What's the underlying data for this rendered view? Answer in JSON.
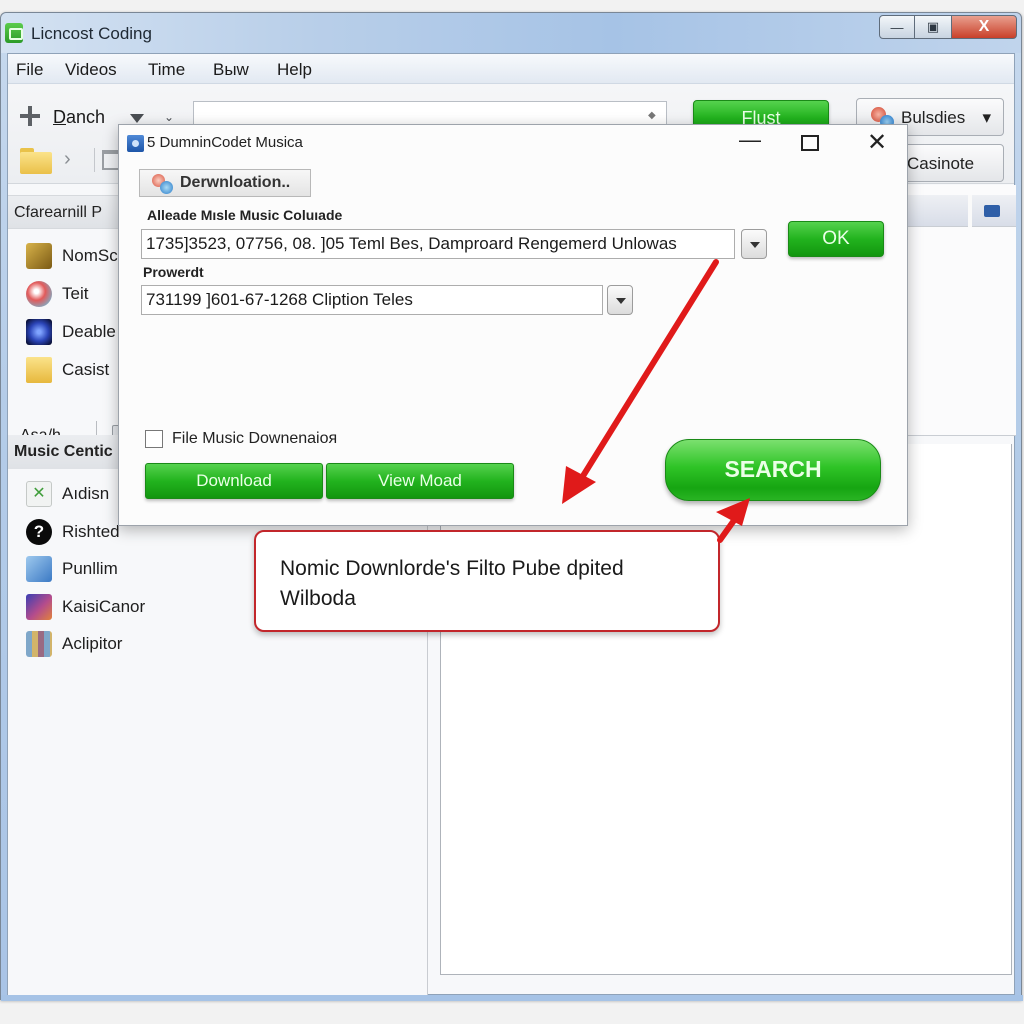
{
  "window": {
    "title": "Licncost Coding",
    "controls": {
      "minimize": "—",
      "maximize": "▣",
      "close": "X"
    }
  },
  "menubar": {
    "items": [
      "File",
      "Videos",
      "Time",
      "Bыw",
      "Help"
    ]
  },
  "toolbar": {
    "add_label": "Danch",
    "address_value": "",
    "flust_label": "Flust",
    "bulsdies_label": "Bulsdies",
    "bulsdies_caret": "▾",
    "casinote_label": "Casinote",
    "chevron_right": "›",
    "chevron_down": "⌄"
  },
  "sidebar": {
    "header1": "Cfarearnill P",
    "items1": [
      {
        "label": "NomSc",
        "icon": "music-folder-icon"
      },
      {
        "label": "Teit",
        "icon": "media-disc-icon"
      },
      {
        "label": "Deable",
        "icon": "globe-icon"
      },
      {
        "label": "Casist",
        "icon": "folder-icon"
      }
    ],
    "asa_label": "Asa/h.",
    "header2": "Music Centic",
    "items2": [
      {
        "label": "Aıdisn",
        "icon": "excel-icon",
        "glyph": "✕"
      },
      {
        "label": "Rishted",
        "icon": "help-icon",
        "glyph": "?"
      },
      {
        "label": "Punllim",
        "icon": "image-icon"
      },
      {
        "label": "KaisiCanor",
        "icon": "media-app-icon"
      },
      {
        "label": "Aclipitor",
        "icon": "photo-grid-icon"
      }
    ]
  },
  "dialog": {
    "title": "5 DumninCodet Musica",
    "controls": {
      "minimize": "—",
      "close": "✕"
    },
    "download_tab": "Derwnloation..",
    "music_field": {
      "label": "Alleade Mısle Music Coluıade",
      "value": "1735]3523, 07756, 08. ]05 Teml Bes, Damproard Rengemerd Unlowas"
    },
    "prowerdt_field": {
      "label": "Prowerdt",
      "value": "731199 ]601-67-1268 Cliption Teles"
    },
    "ok_label": "OK",
    "checkbox": {
      "label": "File Music Downenaioя",
      "checked": false
    },
    "download_label": "Download",
    "view_label": "View Moad",
    "search_label": "SEARCH"
  },
  "callout": {
    "text": "Nomic Downlorde's Filto Pube dpited Wilboda"
  },
  "colors": {
    "accent_green": "#22b31e",
    "annotation_red": "#e01a1a",
    "callout_border": "#c2262b",
    "titlebar_blue": "#a9c4e6"
  }
}
